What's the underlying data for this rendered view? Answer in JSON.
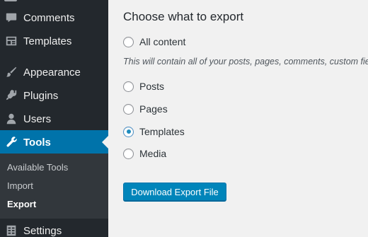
{
  "sidebar": {
    "items": [
      {
        "key": "comments",
        "label": "Comments",
        "icon": "comment-icon"
      },
      {
        "key": "templates",
        "label": "Templates",
        "icon": "templates-icon"
      },
      {
        "key": "appearance",
        "label": "Appearance",
        "icon": "paintbrush-icon"
      },
      {
        "key": "plugins",
        "label": "Plugins",
        "icon": "plug-icon"
      },
      {
        "key": "users",
        "label": "Users",
        "icon": "user-icon"
      },
      {
        "key": "tools",
        "label": "Tools",
        "icon": "wrench-icon",
        "active": true
      },
      {
        "key": "settings",
        "label": "Settings",
        "icon": "settings-icon"
      }
    ],
    "submenu": {
      "available_tools": "Available Tools",
      "import": "Import",
      "export": "Export"
    }
  },
  "main": {
    "heading": "Choose what to export",
    "options": {
      "all_content": "All content",
      "posts": "Posts",
      "pages": "Pages",
      "templates": "Templates",
      "media": "Media"
    },
    "selected_option": "Templates",
    "description": "This will contain all of your posts, pages, comments, custom fie",
    "download_button": "Download Export File"
  },
  "colors": {
    "sidebar_bg": "#23282d",
    "submenu_bg": "#32373c",
    "active_bg": "#0073aa",
    "button_bg": "#0085ba",
    "page_bg": "#f1f1f1"
  }
}
